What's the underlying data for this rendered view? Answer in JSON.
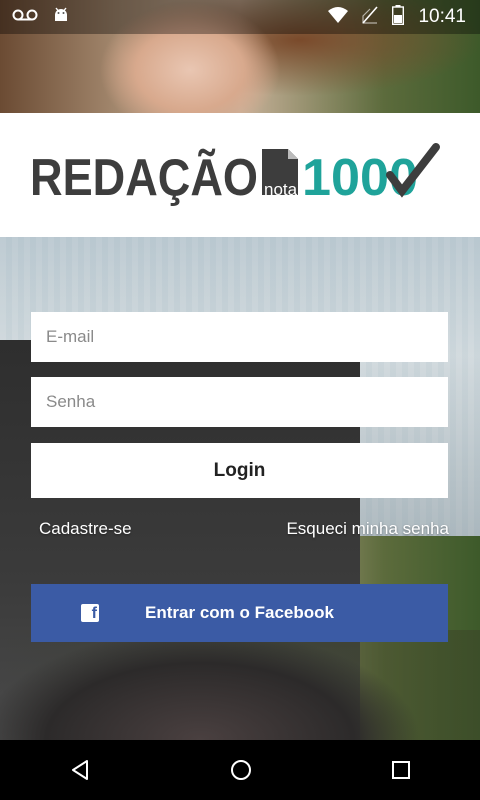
{
  "status_bar": {
    "time": "10:41",
    "icons": [
      "voicemail-icon",
      "android-icon",
      "wifi-icon",
      "no-sim-icon",
      "battery-icon"
    ]
  },
  "logo": {
    "text_main": "REDAÇÃO",
    "text_nota": "nota",
    "text_number": "1000",
    "colors": {
      "dark": "#3d3d3d",
      "teal": "#1fa39a"
    }
  },
  "form": {
    "email_placeholder": "E-mail",
    "password_placeholder": "Senha",
    "login_label": "Login",
    "signup_label": "Cadastre-se",
    "forgot_label": "Esqueci minha senha",
    "facebook_label": "Entrar com o Facebook"
  },
  "colors": {
    "facebook": "#3b5ba5"
  },
  "nav_bar": {
    "icons": [
      "back-icon",
      "home-icon",
      "recents-icon"
    ]
  }
}
